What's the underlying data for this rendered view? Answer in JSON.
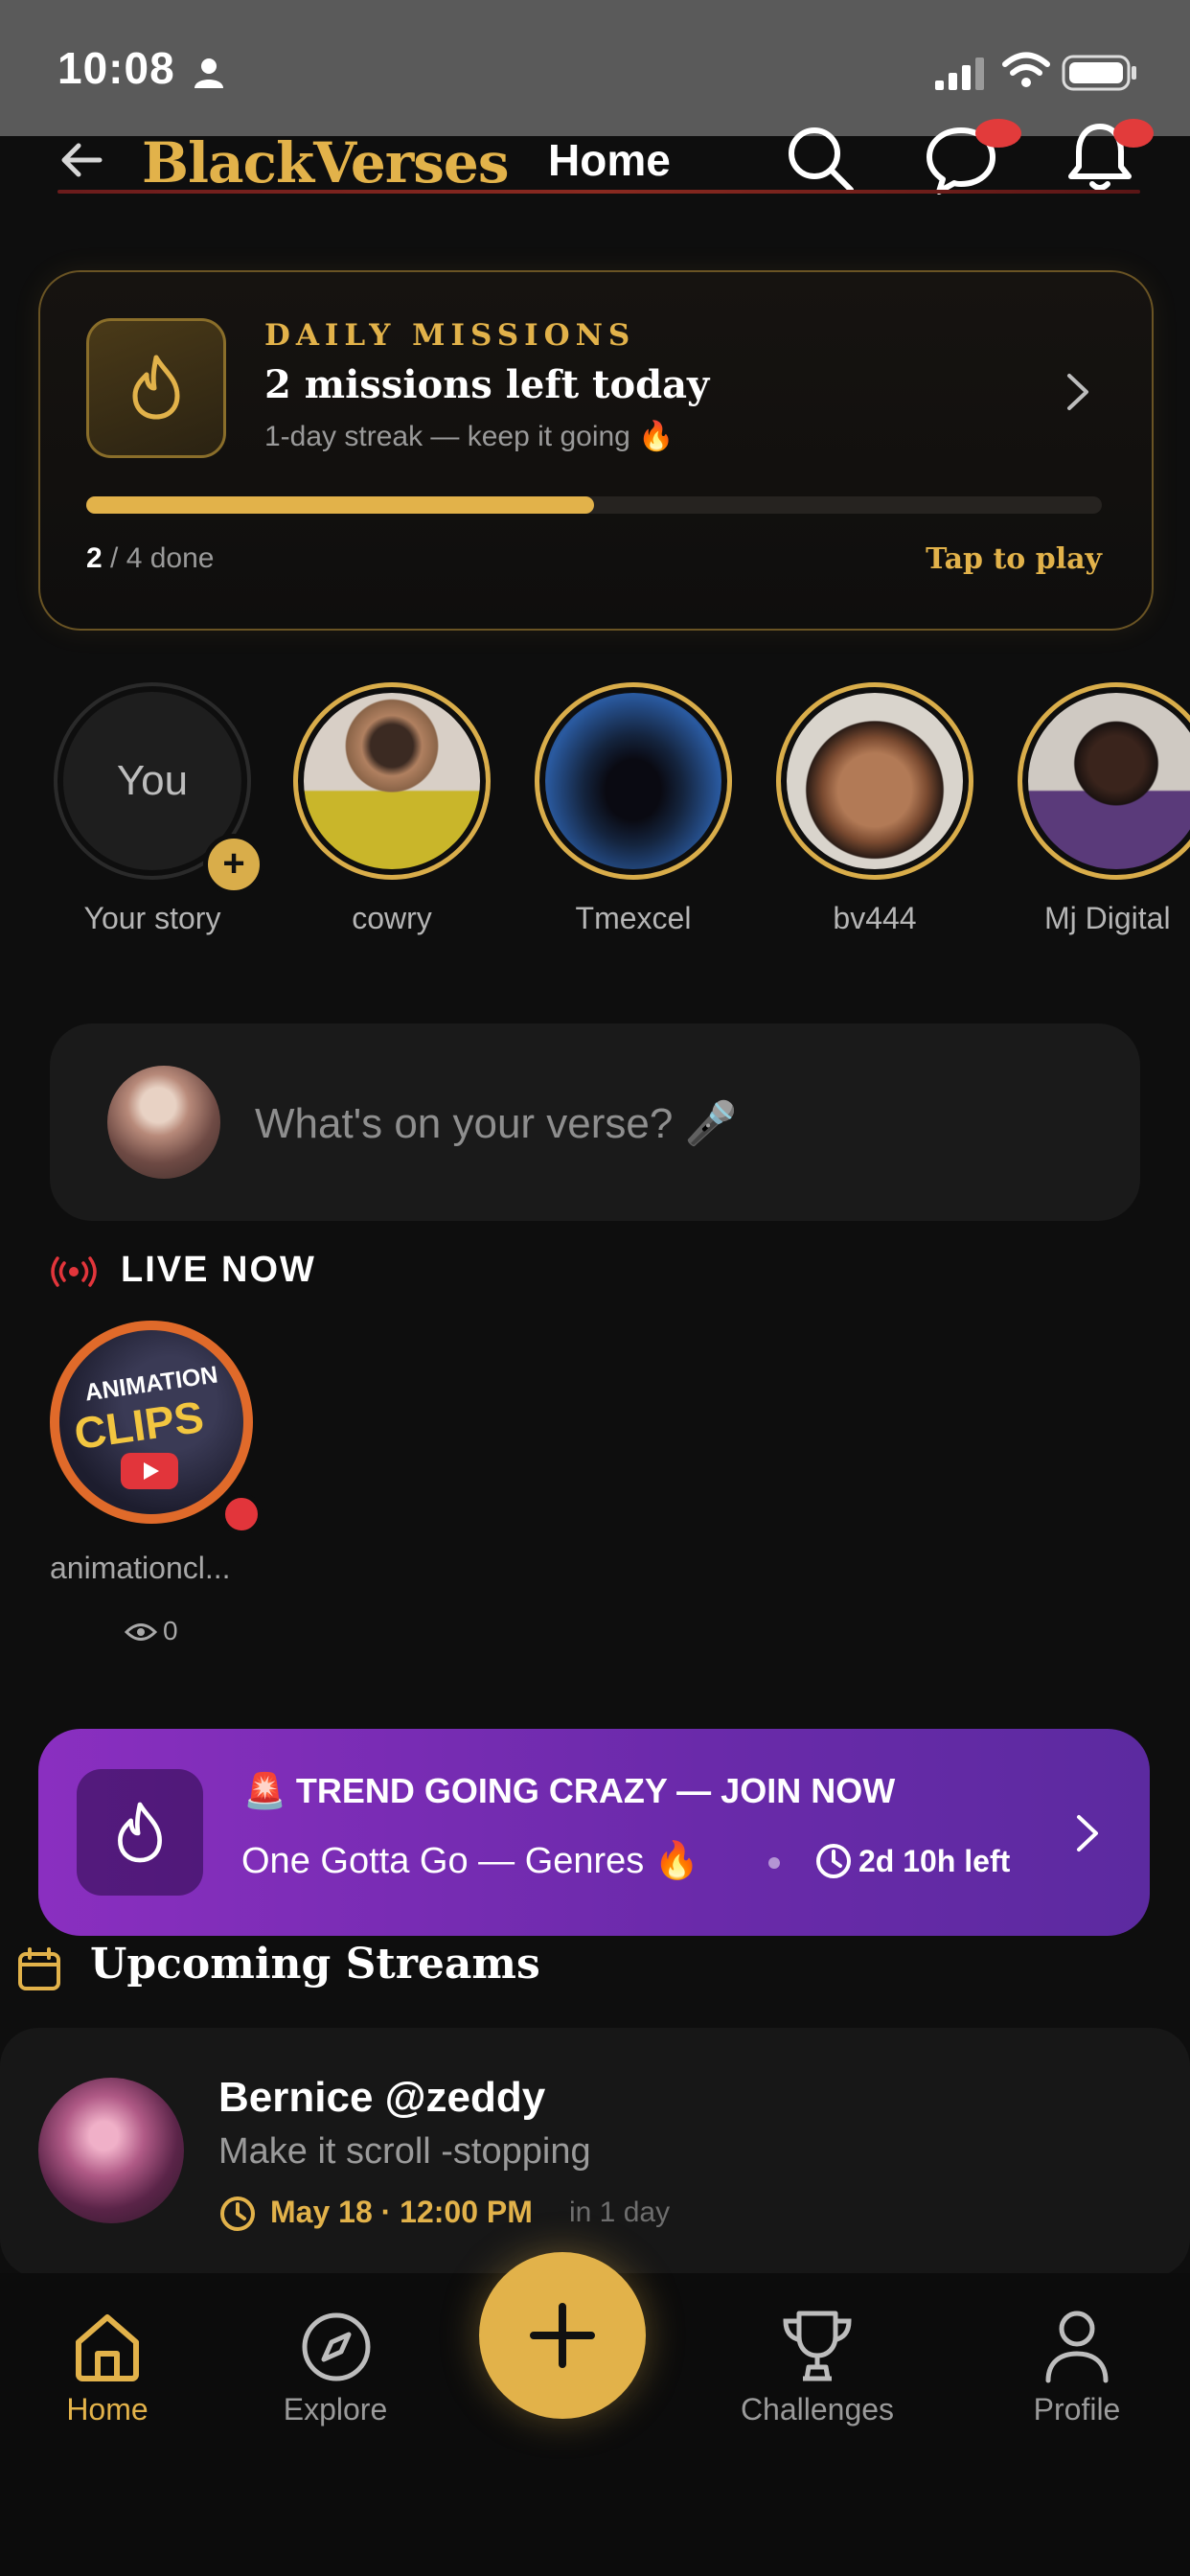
{
  "status_bar": {
    "time": "10:08"
  },
  "header": {
    "brand": "BlackVerses",
    "title": "Home"
  },
  "missions": {
    "label": "DAILY MISSIONS",
    "title": "2 missions left today",
    "streak": "1-day streak — keep it going 🔥",
    "progress": 0.5,
    "done_count": "2",
    "done_rest": " / 4 done",
    "tap": "Tap to play"
  },
  "stories": [
    {
      "avatar_text": "You",
      "name": "Your story"
    },
    {
      "name": "cowry"
    },
    {
      "name": "Tmexcel"
    },
    {
      "name": "bv444"
    },
    {
      "name": "Mj Digital"
    }
  ],
  "composer": {
    "placeholder": "What's on your verse? 🎤"
  },
  "live": {
    "label": "LIVE NOW",
    "items": [
      {
        "name": "animationcl...",
        "views": "0",
        "logo_line1": "ANIMATION",
        "logo_line2": "CLIPS"
      }
    ]
  },
  "trend": {
    "title": "🚨 TREND GOING CRAZY — JOIN NOW",
    "subtitle": "One Gotta Go — Genres 🔥",
    "time_left": "2d 10h left"
  },
  "upcoming": {
    "title": "Upcoming Streams",
    "items": [
      {
        "name": "Bernice @zeddy",
        "subtitle": "Make it scroll -stopping",
        "date": "May 18 · 12:00 PM",
        "relative": "in 1 day"
      }
    ]
  },
  "bottom_nav": {
    "items": [
      {
        "label": "Home",
        "active": true
      },
      {
        "label": "Explore"
      },
      {
        "label": "Challenges"
      },
      {
        "label": "Profile"
      }
    ]
  },
  "colors": {
    "accent": "#e2b24a",
    "live_red": "#e2353b",
    "trend_purple": "#7b2fb8",
    "background": "#0e0e0e"
  }
}
